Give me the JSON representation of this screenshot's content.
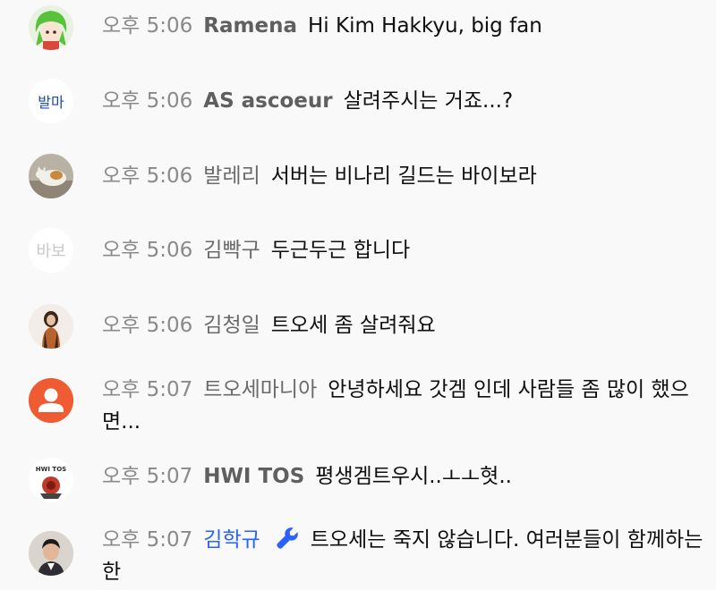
{
  "messages": [
    {
      "time": "오후 5:06",
      "author": "Ramena",
      "text": "Hi Kim Hakkyu, big fan",
      "avatar": "anime-avatar"
    },
    {
      "time": "오후 5:06",
      "author": "AS ascoeur",
      "text": "살려주시는 거죠...?",
      "avatar": "text-avatar",
      "avatar_text": "발마"
    },
    {
      "time": "오후 5:06",
      "author": "발레리",
      "text": "서버는 비나리 길드는 바이보라",
      "avatar": "cat-avatar"
    },
    {
      "time": "오후 5:06",
      "author": "김빡구",
      "text": "두근두근 합니다",
      "avatar": "handwriting-avatar",
      "avatar_text": "바보"
    },
    {
      "time": "오후 5:06",
      "author": "김청일",
      "text": "트오세 좀 살려줘요",
      "avatar": "person-avatar"
    },
    {
      "time": "오후 5:07",
      "author": "트오세마니아",
      "text": "안녕하세요 갓겜 인데 사람들 좀 많이 했으면...",
      "avatar": "default-user-avatar"
    },
    {
      "time": "오후 5:07",
      "author": "HWI TOS",
      "text": "평생겜트우시..ㅗㅗ혓..",
      "avatar": "logo-avatar",
      "avatar_text": "HWI TOS"
    },
    {
      "time": "오후 5:07",
      "author": "김학규",
      "text": "트오세는 죽지 않습니다. 여러분들이 함께하는 한",
      "avatar": "photo-avatar",
      "badge": "wrench-icon"
    }
  ],
  "colors": {
    "background": "#f9f9f9",
    "time": "#8a8a8a",
    "author": "#6a6a6a",
    "moderator": "#2962ff",
    "default_avatar": "#ef5b33"
  }
}
